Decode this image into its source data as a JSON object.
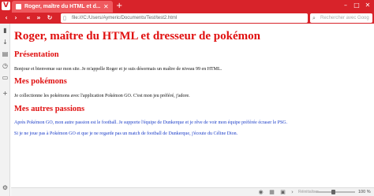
{
  "browser": {
    "tab": {
      "title": "Roger, maître du HTML et d..."
    },
    "address": {
      "url": "file:///C:/Users/Aymeric/Documents/Test/test2.html"
    },
    "search": {
      "placeholder": "Rechercher avec Goog"
    },
    "statusbar": {
      "reset_label": "Réinitialiser",
      "zoom": "100 %"
    },
    "colors": {
      "brand": "#d8232a",
      "heading": "#e01010",
      "link_text": "#1a3cc8"
    }
  },
  "page": {
    "h1": "Roger, maître du HTML et dresseur de pokémon",
    "sections": [
      {
        "title": "Présentation",
        "paragraphs": [
          "Bonjour et bienvenue sur mon site. Je m'appelle Roger et je suis désormais un maître de niveau 99 en HTML."
        ]
      },
      {
        "title": "Mes pokémons",
        "paragraphs": [
          "Je collectionne les pokémons avec l'application Pokémon GO. C'est mon jeu préféré, j'adore."
        ]
      },
      {
        "title": "Mes autres passions",
        "paragraphs": [
          "Après Pokémon GO, mon autre passion est le football. Je supporte l'équipe de Dunkerque et je rêve de voir mon équipe préférée écraser le PSG.",
          "Si je ne joue pas à Pokémon GO et que je ne regarde pas un match de football de Dunkerque, j'écoute du Céline Dion."
        ]
      }
    ]
  }
}
